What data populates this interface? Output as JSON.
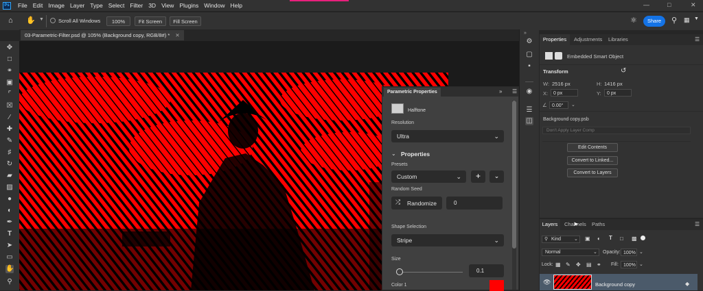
{
  "menubar": {
    "logo": "Ps",
    "items": [
      "File",
      "Edit",
      "Image",
      "Layer",
      "Type",
      "Select",
      "Filter",
      "3D",
      "View",
      "Plugins",
      "Window",
      "Help"
    ]
  },
  "optionsbar": {
    "scroll_all_windows": "Scroll All Windows",
    "zoom_100": "100%",
    "fit_screen": "Fit Screen",
    "fill_screen": "Fill Screen",
    "share": "Share"
  },
  "document": {
    "tab_title": "03-Parametric-Filter.psd @ 105% (Background copy, RGB/8#) *"
  },
  "parametric": {
    "title": "Parametric Properties",
    "filter_name": "Halftone",
    "resolution_label": "Resolution",
    "resolution_value": "Ultra",
    "properties_header": "Properties",
    "presets_label": "Presets",
    "presets_value": "Custom",
    "random_seed_label": "Random Seed",
    "randomize_label": "Randomize",
    "seed_value": "0",
    "shape_selection_label": "Shape Selection",
    "shape_value": "Stripe",
    "size_label": "Size",
    "size_value": "0.1",
    "color1_label": "Color 1",
    "color1": "#ff0000"
  },
  "properties_panel": {
    "tabs": [
      "Properties",
      "Adjustments",
      "Libraries"
    ],
    "smart_object_label": "Embedded Smart Object",
    "transform_header": "Transform",
    "w_label": "W:",
    "w_value": "2516 px",
    "h_label": "H:",
    "h_value": "1416 px",
    "x_label": "X:",
    "x_value": "0 px",
    "y_label": "Y:",
    "y_value": "0 px",
    "angle_value": "0.00°",
    "source_file": "Background copy.psb",
    "layer_comp": "Don't Apply Layer Comp",
    "edit_contents": "Edit Contents",
    "convert_linked": "Convert to Linked...",
    "convert_layers": "Convert to Layers"
  },
  "layers_panel": {
    "tabs": [
      "Layers",
      "Channels",
      "Paths"
    ],
    "kind_label": "Kind",
    "blend_mode": "Normal",
    "opacity_label": "Opacity:",
    "opacity_value": "100%",
    "lock_label": "Lock:",
    "fill_label": "Fill:",
    "fill_value": "100%",
    "layer_name": "Background copy"
  },
  "colors": {
    "accent": "#1473e6",
    "halftone_red": "#ff0000",
    "annotation_arrow": "#e8241e"
  }
}
